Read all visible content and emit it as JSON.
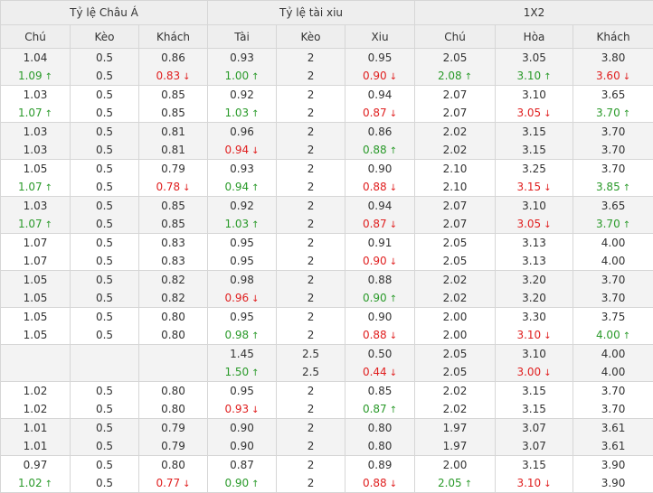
{
  "headers": {
    "groups": [
      "Tỷ lệ Châu Á",
      "Tỷ lệ tài xiu",
      "1X2"
    ],
    "columns": [
      "Chú",
      "Kèo",
      "Khách",
      "Tài",
      "Kèo",
      "Xiu",
      "Chú",
      "Hòa",
      "Khách"
    ]
  },
  "arrows": {
    "up": "↑",
    "down": "↓"
  },
  "colors": {
    "up": "#2a9a2a",
    "down": "#e02020",
    "header_bg": "#eeeeee",
    "row_shade": "#f3f3f3",
    "border": "#d6d6d6"
  },
  "rows": [
    [
      [
        {
          "v": "1.04"
        },
        {
          "v": "1.09",
          "t": "up"
        }
      ],
      [
        {
          "v": "0.5"
        },
        {
          "v": "0.5"
        }
      ],
      [
        {
          "v": "0.86"
        },
        {
          "v": "0.83",
          "t": "down"
        }
      ],
      [
        {
          "v": "0.93"
        },
        {
          "v": "1.00",
          "t": "up"
        }
      ],
      [
        {
          "v": "2"
        },
        {
          "v": "2"
        }
      ],
      [
        {
          "v": "0.95"
        },
        {
          "v": "0.90",
          "t": "down"
        }
      ],
      [
        {
          "v": "2.05"
        },
        {
          "v": "2.08",
          "t": "up"
        }
      ],
      [
        {
          "v": "3.05"
        },
        {
          "v": "3.10",
          "t": "up"
        }
      ],
      [
        {
          "v": "3.80"
        },
        {
          "v": "3.60",
          "t": "down"
        }
      ]
    ],
    [
      [
        {
          "v": "1.03"
        },
        {
          "v": "1.07",
          "t": "up"
        }
      ],
      [
        {
          "v": "0.5"
        },
        {
          "v": "0.5"
        }
      ],
      [
        {
          "v": "0.85"
        },
        {
          "v": "0.85"
        }
      ],
      [
        {
          "v": "0.92"
        },
        {
          "v": "1.03",
          "t": "up"
        }
      ],
      [
        {
          "v": "2"
        },
        {
          "v": "2"
        }
      ],
      [
        {
          "v": "0.94"
        },
        {
          "v": "0.87",
          "t": "down"
        }
      ],
      [
        {
          "v": "2.07"
        },
        {
          "v": "2.07"
        }
      ],
      [
        {
          "v": "3.10"
        },
        {
          "v": "3.05",
          "t": "down"
        }
      ],
      [
        {
          "v": "3.65"
        },
        {
          "v": "3.70",
          "t": "up"
        }
      ]
    ],
    [
      [
        {
          "v": "1.03"
        },
        {
          "v": "1.03"
        }
      ],
      [
        {
          "v": "0.5"
        },
        {
          "v": "0.5"
        }
      ],
      [
        {
          "v": "0.81"
        },
        {
          "v": "0.81"
        }
      ],
      [
        {
          "v": "0.96"
        },
        {
          "v": "0.94",
          "t": "down"
        }
      ],
      [
        {
          "v": "2"
        },
        {
          "v": "2"
        }
      ],
      [
        {
          "v": "0.86"
        },
        {
          "v": "0.88",
          "t": "up"
        }
      ],
      [
        {
          "v": "2.02"
        },
        {
          "v": "2.02"
        }
      ],
      [
        {
          "v": "3.15"
        },
        {
          "v": "3.15"
        }
      ],
      [
        {
          "v": "3.70"
        },
        {
          "v": "3.70"
        }
      ]
    ],
    [
      [
        {
          "v": "1.05"
        },
        {
          "v": "1.07",
          "t": "up"
        }
      ],
      [
        {
          "v": "0.5"
        },
        {
          "v": "0.5"
        }
      ],
      [
        {
          "v": "0.79"
        },
        {
          "v": "0.78",
          "t": "down"
        }
      ],
      [
        {
          "v": "0.93"
        },
        {
          "v": "0.94",
          "t": "up"
        }
      ],
      [
        {
          "v": "2"
        },
        {
          "v": "2"
        }
      ],
      [
        {
          "v": "0.90"
        },
        {
          "v": "0.88",
          "t": "down"
        }
      ],
      [
        {
          "v": "2.10"
        },
        {
          "v": "2.10"
        }
      ],
      [
        {
          "v": "3.25"
        },
        {
          "v": "3.15",
          "t": "down"
        }
      ],
      [
        {
          "v": "3.70"
        },
        {
          "v": "3.85",
          "t": "up"
        }
      ]
    ],
    [
      [
        {
          "v": "1.03"
        },
        {
          "v": "1.07",
          "t": "up"
        }
      ],
      [
        {
          "v": "0.5"
        },
        {
          "v": "0.5"
        }
      ],
      [
        {
          "v": "0.85"
        },
        {
          "v": "0.85"
        }
      ],
      [
        {
          "v": "0.92"
        },
        {
          "v": "1.03",
          "t": "up"
        }
      ],
      [
        {
          "v": "2"
        },
        {
          "v": "2"
        }
      ],
      [
        {
          "v": "0.94"
        },
        {
          "v": "0.87",
          "t": "down"
        }
      ],
      [
        {
          "v": "2.07"
        },
        {
          "v": "2.07"
        }
      ],
      [
        {
          "v": "3.10"
        },
        {
          "v": "3.05",
          "t": "down"
        }
      ],
      [
        {
          "v": "3.65"
        },
        {
          "v": "3.70",
          "t": "up"
        }
      ]
    ],
    [
      [
        {
          "v": "1.07"
        },
        {
          "v": "1.07"
        }
      ],
      [
        {
          "v": "0.5"
        },
        {
          "v": "0.5"
        }
      ],
      [
        {
          "v": "0.83"
        },
        {
          "v": "0.83"
        }
      ],
      [
        {
          "v": "0.95"
        },
        {
          "v": "0.95"
        }
      ],
      [
        {
          "v": "2"
        },
        {
          "v": "2"
        }
      ],
      [
        {
          "v": "0.91"
        },
        {
          "v": "0.90",
          "t": "down"
        }
      ],
      [
        {
          "v": "2.05"
        },
        {
          "v": "2.05"
        }
      ],
      [
        {
          "v": "3.13"
        },
        {
          "v": "3.13"
        }
      ],
      [
        {
          "v": "4.00"
        },
        {
          "v": "4.00"
        }
      ]
    ],
    [
      [
        {
          "v": "1.05"
        },
        {
          "v": "1.05"
        }
      ],
      [
        {
          "v": "0.5"
        },
        {
          "v": "0.5"
        }
      ],
      [
        {
          "v": "0.82"
        },
        {
          "v": "0.82"
        }
      ],
      [
        {
          "v": "0.98"
        },
        {
          "v": "0.96",
          "t": "down"
        }
      ],
      [
        {
          "v": "2"
        },
        {
          "v": "2"
        }
      ],
      [
        {
          "v": "0.88"
        },
        {
          "v": "0.90",
          "t": "up"
        }
      ],
      [
        {
          "v": "2.02"
        },
        {
          "v": "2.02"
        }
      ],
      [
        {
          "v": "3.20"
        },
        {
          "v": "3.20"
        }
      ],
      [
        {
          "v": "3.70"
        },
        {
          "v": "3.70"
        }
      ]
    ],
    [
      [
        {
          "v": "1.05"
        },
        {
          "v": "1.05"
        }
      ],
      [
        {
          "v": "0.5"
        },
        {
          "v": "0.5"
        }
      ],
      [
        {
          "v": "0.80"
        },
        {
          "v": "0.80"
        }
      ],
      [
        {
          "v": "0.95"
        },
        {
          "v": "0.98",
          "t": "up"
        }
      ],
      [
        {
          "v": "2"
        },
        {
          "v": "2"
        }
      ],
      [
        {
          "v": "0.90"
        },
        {
          "v": "0.88",
          "t": "down"
        }
      ],
      [
        {
          "v": "2.00"
        },
        {
          "v": "2.00"
        }
      ],
      [
        {
          "v": "3.30"
        },
        {
          "v": "3.10",
          "t": "down"
        }
      ],
      [
        {
          "v": "3.75"
        },
        {
          "v": "4.00",
          "t": "up"
        }
      ]
    ],
    [
      [],
      [],
      [],
      [
        {
          "v": "1.45"
        },
        {
          "v": "1.50",
          "t": "up"
        }
      ],
      [
        {
          "v": "2.5"
        },
        {
          "v": "2.5"
        }
      ],
      [
        {
          "v": "0.50"
        },
        {
          "v": "0.44",
          "t": "down"
        }
      ],
      [
        {
          "v": "2.05"
        },
        {
          "v": "2.05"
        }
      ],
      [
        {
          "v": "3.10"
        },
        {
          "v": "3.00",
          "t": "down"
        }
      ],
      [
        {
          "v": "4.00"
        },
        {
          "v": "4.00"
        }
      ]
    ],
    [
      [
        {
          "v": "1.02"
        },
        {
          "v": "1.02"
        }
      ],
      [
        {
          "v": "0.5"
        },
        {
          "v": "0.5"
        }
      ],
      [
        {
          "v": "0.80"
        },
        {
          "v": "0.80"
        }
      ],
      [
        {
          "v": "0.95"
        },
        {
          "v": "0.93",
          "t": "down"
        }
      ],
      [
        {
          "v": "2"
        },
        {
          "v": "2"
        }
      ],
      [
        {
          "v": "0.85"
        },
        {
          "v": "0.87",
          "t": "up"
        }
      ],
      [
        {
          "v": "2.02"
        },
        {
          "v": "2.02"
        }
      ],
      [
        {
          "v": "3.15"
        },
        {
          "v": "3.15"
        }
      ],
      [
        {
          "v": "3.70"
        },
        {
          "v": "3.70"
        }
      ]
    ],
    [
      [
        {
          "v": "1.01"
        },
        {
          "v": "1.01"
        }
      ],
      [
        {
          "v": "0.5"
        },
        {
          "v": "0.5"
        }
      ],
      [
        {
          "v": "0.79"
        },
        {
          "v": "0.79"
        }
      ],
      [
        {
          "v": "0.90"
        },
        {
          "v": "0.90"
        }
      ],
      [
        {
          "v": "2"
        },
        {
          "v": "2"
        }
      ],
      [
        {
          "v": "0.80"
        },
        {
          "v": "0.80"
        }
      ],
      [
        {
          "v": "1.97"
        },
        {
          "v": "1.97"
        }
      ],
      [
        {
          "v": "3.07"
        },
        {
          "v": "3.07"
        }
      ],
      [
        {
          "v": "3.61"
        },
        {
          "v": "3.61"
        }
      ]
    ],
    [
      [
        {
          "v": "0.97"
        },
        {
          "v": "1.02",
          "t": "up"
        }
      ],
      [
        {
          "v": "0.5"
        },
        {
          "v": "0.5"
        }
      ],
      [
        {
          "v": "0.80"
        },
        {
          "v": "0.77",
          "t": "down"
        }
      ],
      [
        {
          "v": "0.87"
        },
        {
          "v": "0.90",
          "t": "up"
        }
      ],
      [
        {
          "v": "2"
        },
        {
          "v": "2"
        }
      ],
      [
        {
          "v": "0.89"
        },
        {
          "v": "0.88",
          "t": "down"
        }
      ],
      [
        {
          "v": "2.00"
        },
        {
          "v": "2.05",
          "t": "up"
        }
      ],
      [
        {
          "v": "3.15"
        },
        {
          "v": "3.10",
          "t": "down"
        }
      ],
      [
        {
          "v": "3.90"
        },
        {
          "v": "3.90"
        }
      ]
    ]
  ]
}
